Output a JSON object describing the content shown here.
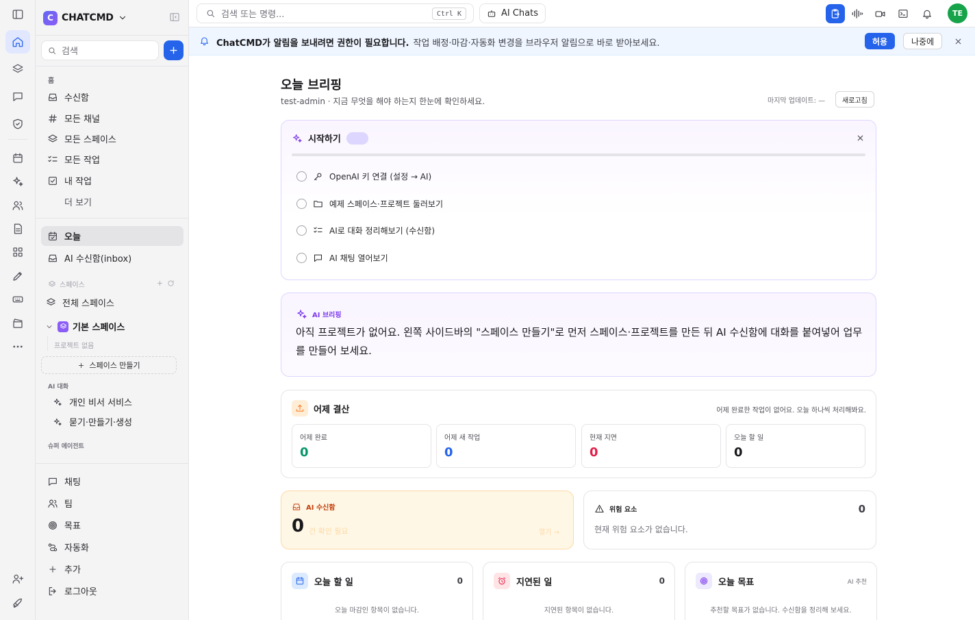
{
  "workspace": {
    "logo_letter": "C",
    "name": "CHATCMD"
  },
  "sidebar": {
    "search_placeholder": "검색",
    "home_section": "홈",
    "home_items": [
      {
        "label": "수신함",
        "icon": "inbox-icon"
      },
      {
        "label": "모든 채널",
        "icon": "hash-icon"
      },
      {
        "label": "모든 스페이스",
        "icon": "layers-icon"
      },
      {
        "label": "모든 작업",
        "icon": "list-check-icon"
      },
      {
        "label": "내 작업",
        "icon": "checkbox-icon"
      },
      {
        "label": "더 보기",
        "icon": ""
      }
    ],
    "today": "오늘",
    "ai_inbox": "AI 수신함(inbox)",
    "spaces_section": "스페이스",
    "all_spaces": "전체 스페이스",
    "basic_space": "기본 스페이스",
    "no_projects": "프로젝트 없음",
    "create_space": "스페이스 만들기",
    "ai_chat_section": "AI 대화",
    "ai_chats": [
      "개인 비서 서비스",
      "묻기·만들기·생성"
    ],
    "super_agent_section": "슈퍼 에이전트",
    "bottom_items": [
      {
        "label": "채팅",
        "icon": "chat-icon"
      },
      {
        "label": "팀",
        "icon": "team-icon"
      },
      {
        "label": "목표",
        "icon": "target-icon"
      },
      {
        "label": "자동화",
        "icon": "automation-icon"
      },
      {
        "label": "추가",
        "icon": "plus-icon"
      },
      {
        "label": "로그아웃",
        "icon": "logout-icon"
      }
    ]
  },
  "topbar": {
    "search_placeholder": "검색 또는 명령...",
    "shortcut": "Ctrl K",
    "ai_chats": "AI Chats",
    "avatar": "TE"
  },
  "banner": {
    "title": "ChatCMD가 알림을 보내려면 권한이 필요합니다.",
    "body": "작업 배정·마감·자동화 변경을 브라우저 알림으로 바로 받아보세요.",
    "allow": "허용",
    "later": "나중에"
  },
  "briefing": {
    "title": "오늘 브리핑",
    "subtitle": "test-admin · 지금 무엇을 해야 하는지 한눈에 확인하세요.",
    "last_update": "마지막 업데이트: —",
    "refresh": "새로고침"
  },
  "getting_started": {
    "title": "시작하기",
    "progress": 0,
    "items": [
      {
        "label": "OpenAI 키 연결 (설정 → AI)",
        "icon": "key-icon"
      },
      {
        "label": "예제 스페이스·프로젝트 둘러보기",
        "icon": "folder-icon"
      },
      {
        "label": "AI로 대화 정리해보기 (수신함)",
        "icon": "list-check-icon"
      },
      {
        "label": "AI 채팅 열어보기",
        "icon": "chat-icon"
      }
    ]
  },
  "ai_briefing": {
    "tag": "AI 브리핑",
    "body": "아직 프로젝트가 없어요. 왼쪽 사이드바의 \"스페이스 만들기\"로 먼저 스페이스·프로젝트를 만든 뒤 AI 수신함에 대화를 붙여넣어 업무를 만들어 보세요."
  },
  "yesterday": {
    "title": "어제 결산",
    "note": "어제 완료한 작업이 없어요. 오늘 하나씩 처리해봐요.",
    "stats": [
      {
        "label": "어제 완료",
        "value": "0",
        "color": "#059669"
      },
      {
        "label": "어제 새 작업",
        "value": "0",
        "color": "#2563eb"
      },
      {
        "label": "현재 지연",
        "value": "0",
        "color": "#e11d48"
      },
      {
        "label": "오늘 할 일",
        "value": "0",
        "color": "#18181b"
      }
    ]
  },
  "ai_inbox_card": {
    "title": "AI 수신함",
    "count": "0",
    "need": "건 확인 필요",
    "open": "열기 →"
  },
  "risk": {
    "title": "위험 요소",
    "count": "0",
    "body": "현재 위험 요소가 없습니다."
  },
  "minis": [
    {
      "title": "오늘 할 일",
      "count": "0",
      "empty": "오늘 마감인 항목이 없습니다."
    },
    {
      "title": "지연된 일",
      "count": "0",
      "empty": "지연된 항목이 없습니다."
    },
    {
      "title": "오늘 목표",
      "tag": "AI 추천",
      "empty": "추천할 목표가 없습니다. 수신함을 정리해 보세요."
    }
  ],
  "colors": {
    "primary": "#2563eb",
    "success": "#16a34a",
    "violet": "#7c3aed",
    "danger": "#e11d48"
  }
}
